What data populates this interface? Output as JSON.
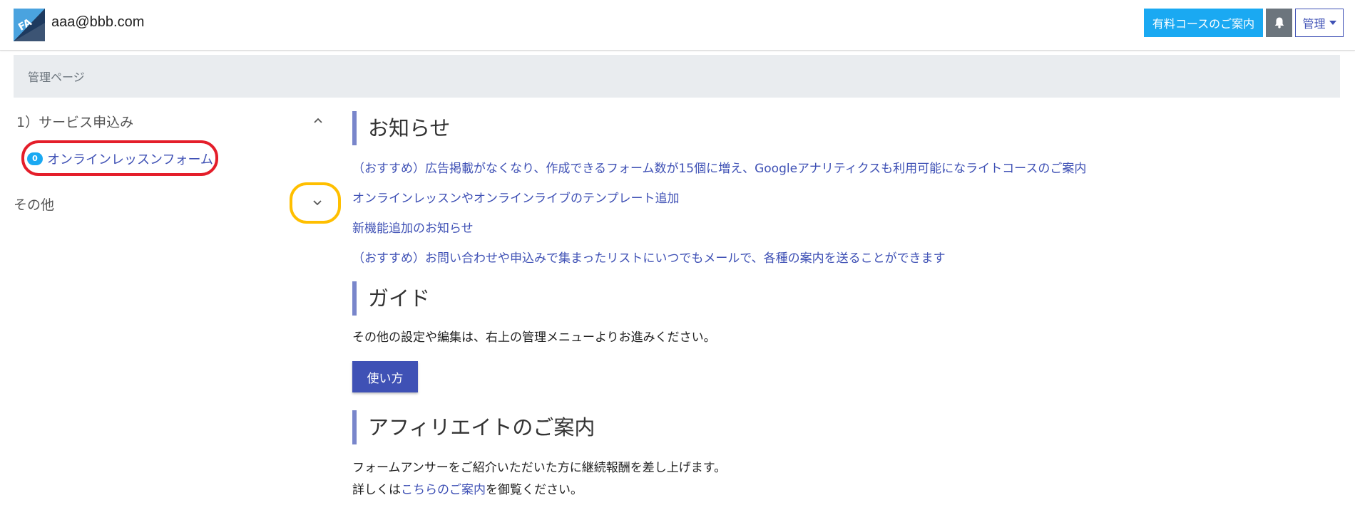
{
  "header": {
    "user_email": "aaa@bbb.com",
    "course_button": "有料コースのご案内",
    "admin_button": "管理"
  },
  "breadcrumb": {
    "text": "管理ページ"
  },
  "sidebar": {
    "sections": [
      {
        "title": "1）サービス申込み",
        "items": [
          {
            "badge": "0",
            "label": "オンラインレッスンフォーム"
          }
        ]
      },
      {
        "title": "その他",
        "items": []
      }
    ]
  },
  "main": {
    "news": {
      "title": "お知らせ",
      "links": [
        "（おすすめ）広告掲載がなくなり、作成できるフォーム数が15個に増え、Googleアナリティクスも利用可能になライトコースのご案内",
        "オンラインレッスンやオンラインライブのテンプレート追加",
        "新機能追加のお知らせ",
        "（おすすめ）お問い合わせや申込みで集まったリストにいつでもメールで、各種の案内を送ることができます"
      ]
    },
    "guide": {
      "title": "ガイド",
      "text": "その他の設定や編集は、右上の管理メニューよりお進みください。",
      "button": "使い方"
    },
    "affiliate": {
      "title": "アフィリエイトのご案内",
      "text1": "フォームアンサーをご紹介いただいた方に継続報酬を差し上げます。",
      "text2_prefix": "詳しくは",
      "text2_link": "こちらのご案内",
      "text2_suffix": "を御覧ください。"
    }
  },
  "colors": {
    "accent": "#3f51b5",
    "info": "#1aa9f2",
    "secondary": "#6c757d",
    "section_border": "#7986cb",
    "annotation_red": "#e41e2a",
    "annotation_yellow": "#ffbf00"
  }
}
